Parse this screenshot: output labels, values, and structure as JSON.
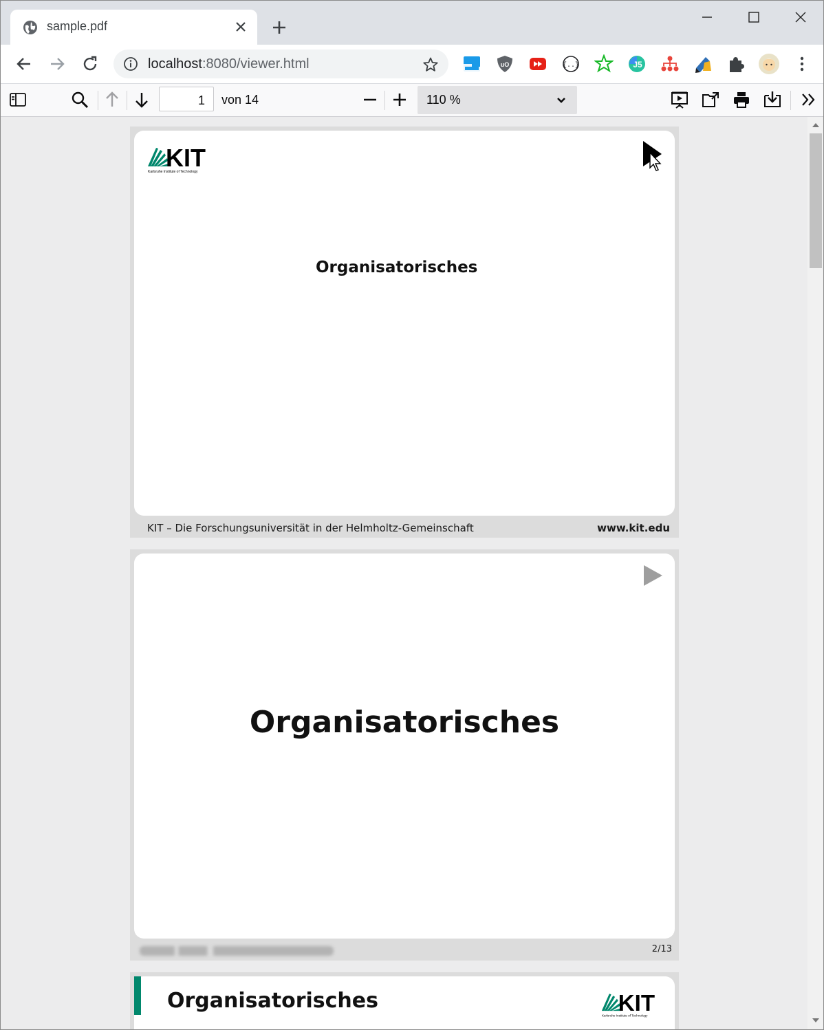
{
  "tab": {
    "title": "sample.pdf"
  },
  "address": {
    "host": "localhost",
    "rest": ":8080/viewer.html"
  },
  "pdf_toolbar": {
    "page_number": "1",
    "page_count": "von 14",
    "zoom": "110 %"
  },
  "pages": [
    {
      "title": "Organisatorisches",
      "footer_left": "KIT – Die Forschungsuniversität in der Helmholtz-Gemeinschaft",
      "footer_right": "www.kit.edu"
    },
    {
      "title": "Organisatorisches",
      "footer_right": "2/13"
    },
    {
      "title": "Organisatorisches"
    }
  ],
  "logo": {
    "text": "KIT",
    "subtitle": "Karlsruhe Institute of Technology"
  },
  "colors": {
    "kit_green": "#00876c",
    "tab_strip": "#dee1e6"
  },
  "icons": {
    "toolbar": [
      "back-icon",
      "forward-icon",
      "reload-icon",
      "info-icon",
      "star-icon"
    ],
    "extensions": [
      "cloud-extension-icon",
      "ublock-icon",
      "youtube-extension-icon",
      "json-extension-icon",
      "star-extension-icon",
      "js-extension-icon",
      "tree-extension-icon",
      "pen-extension-icon",
      "puzzle-icon",
      "profile-avatar",
      "more-menu-icon"
    ],
    "pdf": [
      "sidebar-toggle-icon",
      "search-icon",
      "previous-page-icon",
      "next-page-icon",
      "zoom-out-icon",
      "zoom-in-icon",
      "presentation-mode-icon",
      "open-file-icon",
      "print-icon",
      "download-icon",
      "more-tools-icon"
    ]
  }
}
